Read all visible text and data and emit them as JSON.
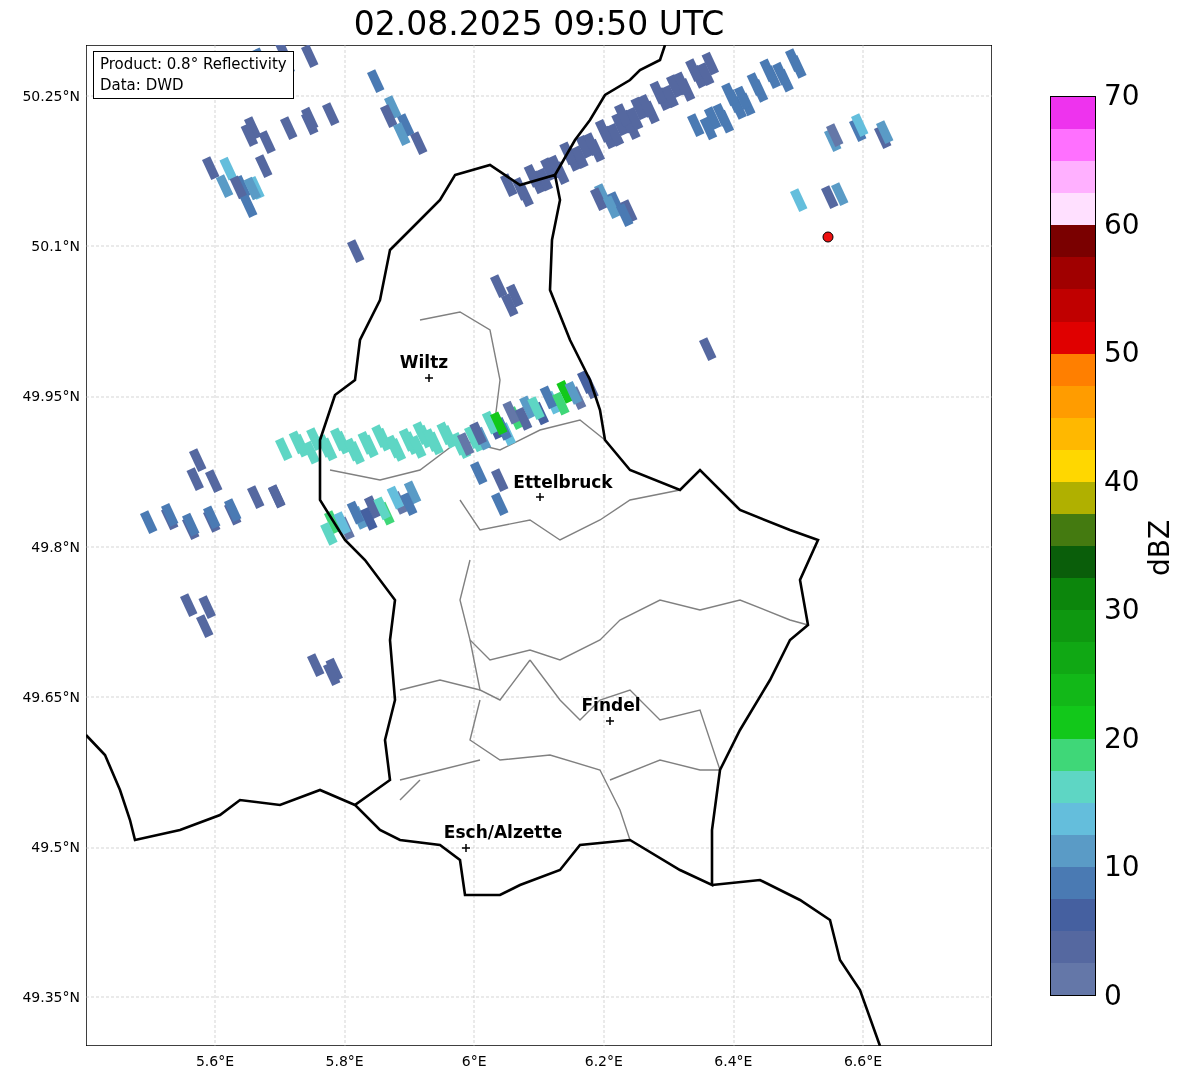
{
  "title": "02.08.2025 09:50 UTC",
  "info_box": [
    "Product: 0.8° Reflectivity",
    "Data: DWD"
  ],
  "x_ticks": [
    "5.6°E",
    "5.8°E",
    "6°E",
    "6.2°E",
    "6.4°E",
    "6.6°E"
  ],
  "y_ticks": [
    "50.25°N",
    "50.1°N",
    "49.95°N",
    "49.8°N",
    "49.65°N",
    "49.5°N",
    "49.35°N"
  ],
  "places": [
    {
      "name": "Wiltz"
    },
    {
      "name": "Ettelbruck"
    },
    {
      "name": "Findel"
    },
    {
      "name": "Esch/Alzette"
    }
  ],
  "colorbar": {
    "label": "dBZ",
    "ticks": [
      "70",
      "60",
      "50",
      "40",
      "30",
      "20",
      "10",
      "0"
    ],
    "segments": [
      {
        "color": "#ee33ee"
      },
      {
        "color": "#ff70ff"
      },
      {
        "color": "#ffb0ff"
      },
      {
        "color": "#ffe0ff"
      },
      {
        "color": "#7a0000"
      },
      {
        "color": "#a00000"
      },
      {
        "color": "#c00000"
      },
      {
        "color": "#e00000"
      },
      {
        "color": "#ff7f00"
      },
      {
        "color": "#ff9c00"
      },
      {
        "color": "#ffb800"
      },
      {
        "color": "#ffd700"
      },
      {
        "color": "#b0b000"
      },
      {
        "color": "#447a10"
      },
      {
        "color": "#0a5e0a"
      },
      {
        "color": "#0c860c"
      },
      {
        "color": "#0e9810"
      },
      {
        "color": "#10a814"
      },
      {
        "color": "#12b818"
      },
      {
        "color": "#12c81a"
      },
      {
        "color": "#3fd778"
      },
      {
        "color": "#5ed6c4"
      },
      {
        "color": "#64bedc"
      },
      {
        "color": "#5a9bc6"
      },
      {
        "color": "#4a7ab3"
      },
      {
        "color": "#4560a0"
      },
      {
        "color": "#5568a0"
      },
      {
        "color": "#6477a8"
      }
    ]
  }
}
